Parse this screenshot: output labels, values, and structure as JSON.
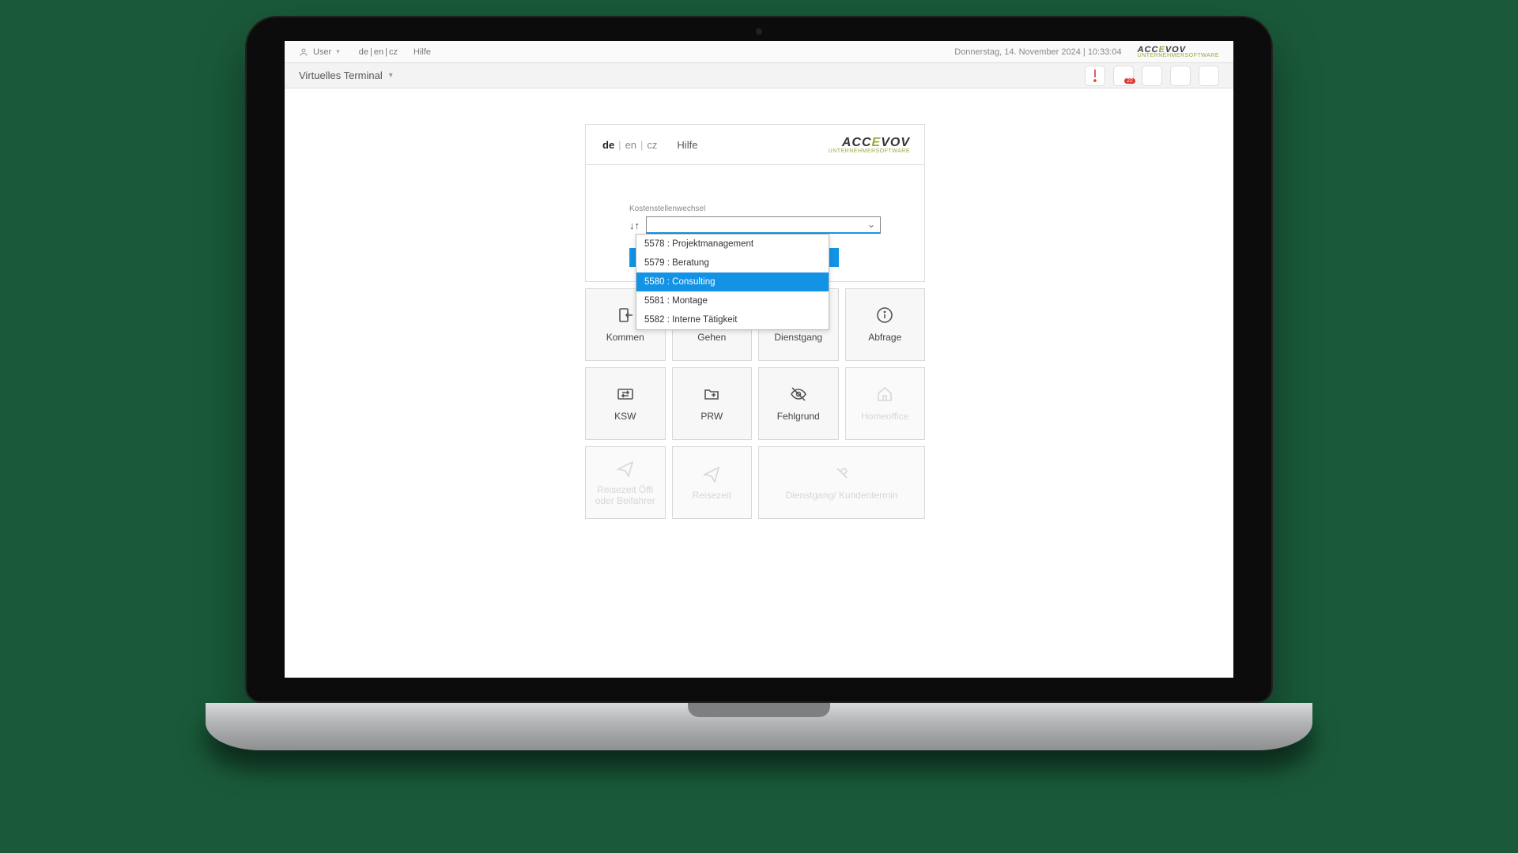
{
  "topbar": {
    "user": "User",
    "languages": [
      "de",
      "en",
      "cz"
    ],
    "help": "Hilfe",
    "datetime": "Donnerstag, 14. November 2024 | 10:33:04",
    "brand": "ACCEVOV",
    "brand_sub": "UNTERNEHMERSOFTWARE"
  },
  "secondbar": {
    "title": "Virtuelles Terminal"
  },
  "panel": {
    "languages": {
      "de": "de",
      "en": "en",
      "cz": "cz"
    },
    "help": "Hilfe",
    "brand": "ACCEVOV",
    "brand_sub": "UNTERNEHMERSOFTWARE",
    "field_label": "Kostenstellenwechsel",
    "options": [
      "5578 : Projektmanagement",
      "5579 : Beratung",
      "5580 : Consulting",
      "5581 : Montage",
      "5582 : Interne Tätigkeit"
    ],
    "selected_index": 2
  },
  "tiles": [
    {
      "label": "Kommen",
      "icon": "login",
      "dis": false
    },
    {
      "label": "Gehen",
      "icon": "logout",
      "dis": false
    },
    {
      "label": "Dienstgang",
      "icon": "briefcase",
      "dis": false
    },
    {
      "label": "Abfrage",
      "icon": "info",
      "dis": false
    },
    {
      "label": "KSW",
      "icon": "swap",
      "dis": false
    },
    {
      "label": "PRW",
      "icon": "folder",
      "dis": false
    },
    {
      "label": "Fehlgrund",
      "icon": "noeye",
      "dis": false
    },
    {
      "label": "Homeoffice",
      "icon": "home",
      "dis": true
    },
    {
      "label": "Reisezeit Öffi oder Beifahrer",
      "icon": "plane",
      "dis": true
    },
    {
      "label": "Reisezeit",
      "icon": "plane",
      "dis": true
    },
    {
      "label": "Dienstgang/ Kundentermin",
      "icon": "tools",
      "dis": true,
      "wide": true
    }
  ]
}
